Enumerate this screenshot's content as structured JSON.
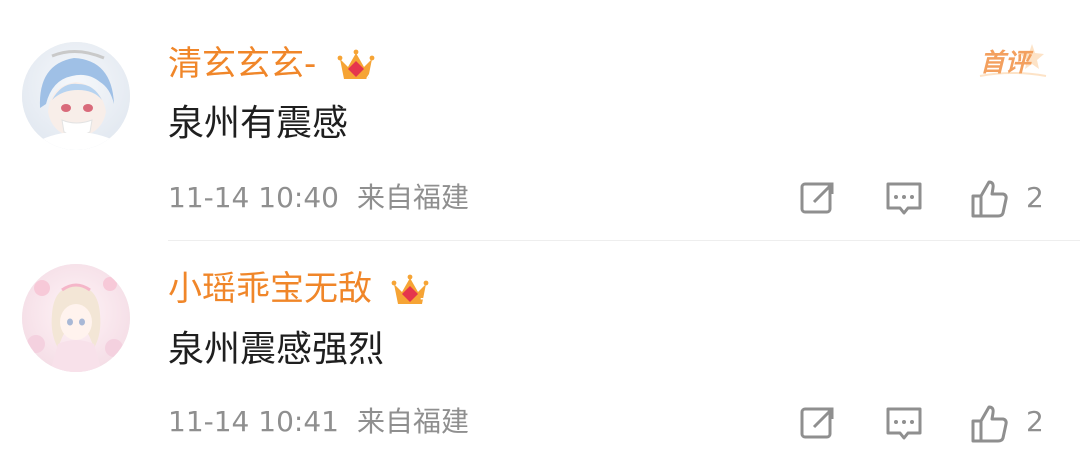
{
  "comments": [
    {
      "username": "清玄玄玄-",
      "text": "泉州有震感",
      "timestamp": "11-14 10:40",
      "location": "来自福建",
      "likes": "2",
      "badge": "首评",
      "crown_level": "4"
    },
    {
      "username": "小瑶乖宝无敌",
      "text": "泉州震感强烈",
      "timestamp": "11-14 10:41",
      "location": "来自福建",
      "likes": "2",
      "crown_level": "7"
    }
  ],
  "colors": {
    "username": "#f08629",
    "text": "#1f1f1f",
    "meta": "#8f8f8f",
    "badge": "#f3a05f",
    "divider": "#eeeeee"
  },
  "icons": [
    "share-icon",
    "comment-icon",
    "like-icon",
    "crown-icon",
    "first-comment-badge-icon"
  ]
}
